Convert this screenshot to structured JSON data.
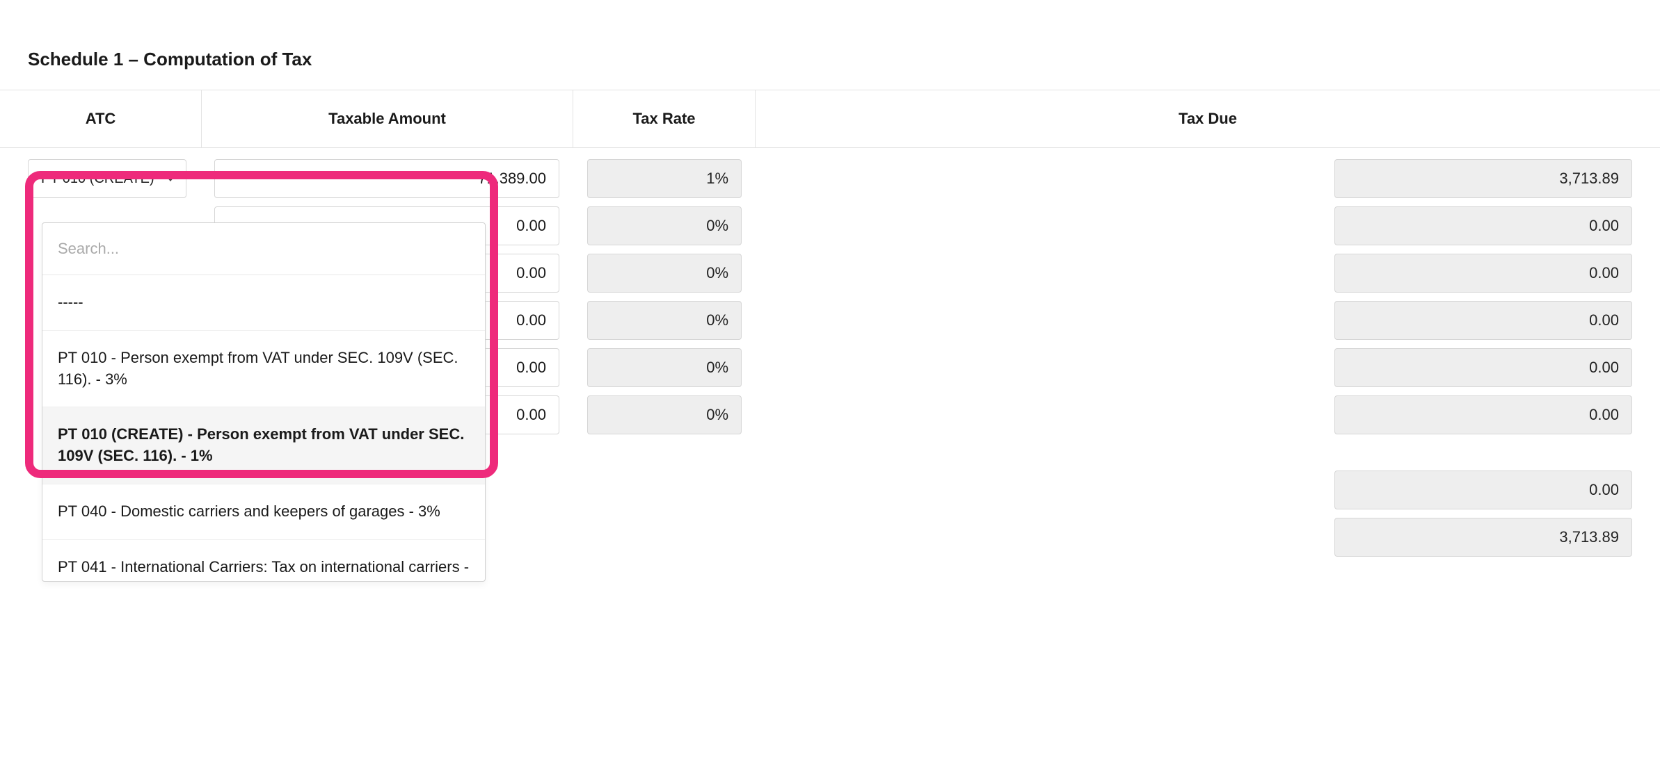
{
  "page": {
    "title": "Schedule 1 – Computation of Tax"
  },
  "columns": {
    "atc": "ATC",
    "amount": "Taxable Amount",
    "rate": "Tax Rate",
    "due": "Tax Due"
  },
  "rows": [
    {
      "atc": "PT 010 (CREATE)",
      "amount": "71,389.00",
      "rate": "1%",
      "due": "3,713.89"
    },
    {
      "atc": "",
      "amount": "0.00",
      "rate": "0%",
      "due": "0.00"
    },
    {
      "atc": "",
      "amount": "0.00",
      "rate": "0%",
      "due": "0.00"
    },
    {
      "atc": "",
      "amount": "0.00",
      "rate": "0%",
      "due": "0.00"
    },
    {
      "atc": "",
      "amount": "0.00",
      "rate": "0%",
      "due": "0.00"
    },
    {
      "atc": "",
      "amount": "0.00",
      "rate": "0%",
      "due": "0.00"
    }
  ],
  "totals": {
    "subtotal_due": "0.00",
    "total_due": "3,713.89"
  },
  "dropdown": {
    "search_placeholder": "Search...",
    "items": [
      {
        "label": "-----",
        "selected": false
      },
      {
        "label": "PT 010 - Person exempt from VAT under SEC. 109V (SEC. 116). - 3%",
        "selected": false
      },
      {
        "label": "PT 010 (CREATE) - Person exempt from VAT under SEC. 109V (SEC. 116). - 1%",
        "selected": true
      },
      {
        "label": "PT 040 - Domestic carriers and keepers of garages - 3%",
        "selected": false
      },
      {
        "label": "PT 041 - International Carriers: Tax on international carriers   -",
        "selected": false,
        "cut": true
      }
    ]
  }
}
